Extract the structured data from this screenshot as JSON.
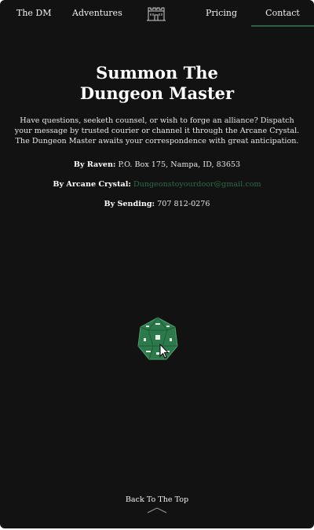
{
  "nav": {
    "items": [
      {
        "label": "The DM"
      },
      {
        "label": "Adventures"
      },
      {
        "label": "Pricing"
      },
      {
        "label": "Contact",
        "active": true
      }
    ],
    "logo_icon": "castle-icon",
    "active_color": "#2f5e43"
  },
  "page": {
    "title_line1": "Summon The",
    "title_line2": "Dungeon Master",
    "intro": "Have questions, seeketh counsel, or wish to forge an alliance? Dispatch your message by trusted courier or channel it through the Arcane Crystal. The Dungeon Master awaits your correspondence with great anticipation."
  },
  "contacts": {
    "raven_label": "By Raven:",
    "raven_value": "P.O. Box 175, Nampa, ID, 83653",
    "crystal_label": "By Arcane Crystal:",
    "crystal_value": "Dungeonstoyourdoor@gmail.com",
    "sending_label": "By Sending:",
    "sending_value": "707 812-0276"
  },
  "footer": {
    "back_to_top": "Back To The Top",
    "chevron_icon": "chevron-up-icon"
  },
  "icons": {
    "die": "d20-die-icon",
    "cursor": "mouse-pointer-icon"
  },
  "colors": {
    "background": "#121212",
    "accent": "#2f5e43",
    "link": "#2e6b46",
    "die": "#2c7a4b"
  }
}
